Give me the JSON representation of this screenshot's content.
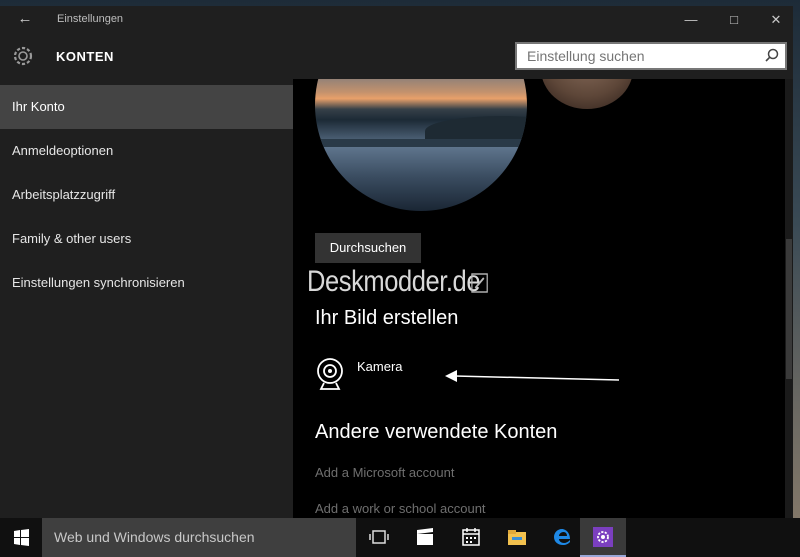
{
  "window": {
    "title": "Einstellungen",
    "heading": "KONTEN",
    "search_placeholder": "Einstellung suchen"
  },
  "sidebar": {
    "items": [
      {
        "label": "Ihr Konto",
        "active": true
      },
      {
        "label": "Anmeldeoptionen",
        "active": false
      },
      {
        "label": "Arbeitsplatzzugriff",
        "active": false
      },
      {
        "label": "Family & other users",
        "active": false
      },
      {
        "label": "Einstellungen synchronisieren",
        "active": false
      }
    ]
  },
  "content": {
    "browse_label": "Durchsuchen",
    "watermark": "Deskmodder.de",
    "create_heading": "Ihr Bild erstellen",
    "camera_label": "Kamera",
    "other_accounts_heading": "Andere verwendete Konten",
    "links": [
      "Add a Microsoft account",
      "Add a work or school account"
    ]
  },
  "taskbar": {
    "search_text": "Web und Windows durchsuchen",
    "colors": {
      "accent": "#7b3fbf",
      "edge": "#1e88e5",
      "explorer": "#f2c14e"
    }
  }
}
